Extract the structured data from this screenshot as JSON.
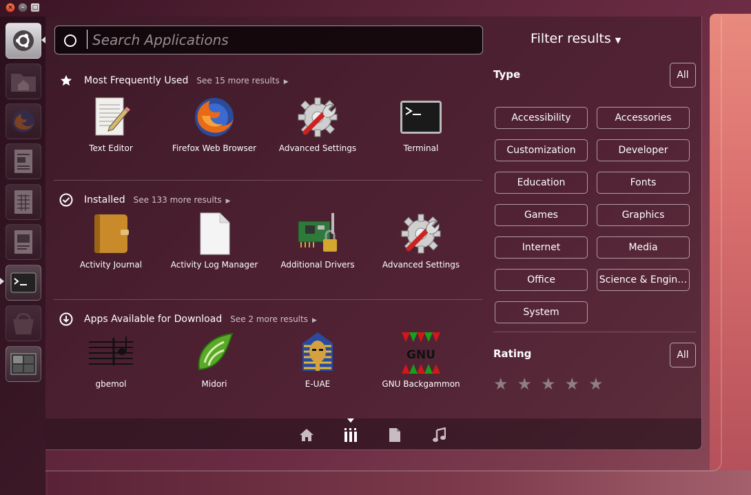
{
  "search": {
    "placeholder": "Search Applications",
    "value": ""
  },
  "filter": {
    "title": "Filter results",
    "dropdown_icon": "triangle-down-icon"
  },
  "sections": [
    {
      "title": "Most Frequently Used",
      "more": "See 15 more results",
      "icon": "star-icon",
      "apps": [
        {
          "name": "Text Editor",
          "icon": "text-editor-icon"
        },
        {
          "name": "Firefox Web Browser",
          "icon": "firefox-icon"
        },
        {
          "name": "Advanced Settings",
          "icon": "settings-gear-icon"
        },
        {
          "name": "Terminal",
          "icon": "terminal-icon"
        }
      ]
    },
    {
      "title": "Installed",
      "more": "See 133 more results",
      "icon": "check-circle-icon",
      "apps": [
        {
          "name": "Activity Journal",
          "icon": "journal-icon"
        },
        {
          "name": "Activity Log Manager",
          "icon": "document-icon"
        },
        {
          "name": "Additional Drivers",
          "icon": "drivers-icon"
        },
        {
          "name": "Advanced Settings",
          "icon": "settings-gear-icon"
        }
      ]
    },
    {
      "title": "Apps Available for Download",
      "more": "See 2 more results",
      "icon": "download-circle-icon",
      "apps": [
        {
          "name": "gbemol",
          "icon": "music-staff-icon"
        },
        {
          "name": "Midori",
          "icon": "midori-leaf-icon"
        },
        {
          "name": "E-UAE",
          "icon": "pharaoh-icon"
        },
        {
          "name": "GNU Backgammon",
          "icon": "backgammon-icon",
          "icon_text": "GNU"
        }
      ]
    }
  ],
  "type_filter": {
    "title": "Type",
    "all_label": "All",
    "categories": [
      "Accessibility",
      "Accessories",
      "Customization",
      "Developer",
      "Education",
      "Fonts",
      "Games",
      "Graphics",
      "Internet",
      "Media",
      "Office",
      "Science & Engin…",
      "System"
    ]
  },
  "rating_filter": {
    "title": "Rating",
    "all_label": "All",
    "stars": 5
  },
  "lenses": [
    "home-icon",
    "applications-icon",
    "files-icon",
    "music-icon"
  ],
  "active_lens": "applications-icon"
}
